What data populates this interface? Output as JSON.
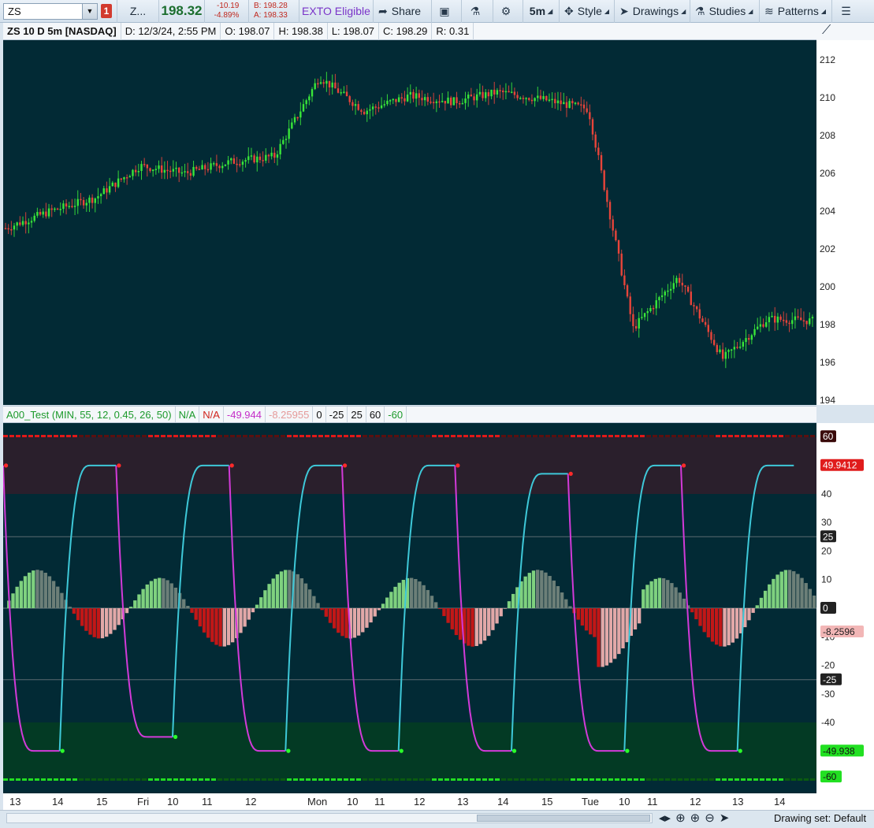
{
  "toolbar": {
    "symbol": "ZS",
    "link_badge": "1",
    "symbol_short": "Z...",
    "last": "198.32",
    "change": "-10.19",
    "change_pct": "-4.89%",
    "bid": "B: 198.28",
    "ask": "A: 198.33",
    "exto": "EXTO Eligible",
    "share": "Share",
    "timeframe": "5m",
    "style": "Style",
    "drawings": "Drawings",
    "studies": "Studies",
    "patterns": "Patterns"
  },
  "infobar": {
    "title": "ZS 10 D 5m [NASDAQ]",
    "date": "D: 12/3/24, 2:55 PM",
    "open": "O: 198.07",
    "high": "H: 198.38",
    "low": "L: 198.07",
    "close": "C: 198.29",
    "range": "R: 0.31"
  },
  "studybar": {
    "name": "A00_Test (MIN, 55, 12, 0.45, 26, 50)",
    "v1": "N/A",
    "v2": "N/A",
    "v3": "-49.944",
    "v4": "-8.25955",
    "v5": "0",
    "v6": "-25",
    "v7": "25",
    "v8": "60",
    "v9": "-60"
  },
  "price_axis": [
    "212",
    "210",
    "208",
    "206",
    "204",
    "202",
    "200",
    "198",
    "196",
    "194"
  ],
  "osc_axis": [
    "40",
    "30",
    "20",
    "10",
    "-10",
    "-20",
    "-30",
    "-40"
  ],
  "osc_badges": {
    "b60": "60",
    "b_cur": "49.9412",
    "b25": "25",
    "b0": "0",
    "b_hist": "-8.2596",
    "bm25": "-25",
    "b_low": "-49.938",
    "bm60": "-60"
  },
  "x_labels": [
    "13",
    "14",
    "15",
    "Fri",
    "10",
    "11",
    "12",
    "Mon",
    "10",
    "11",
    "12",
    "13",
    "14",
    "15",
    "Tue",
    "10",
    "11",
    "12",
    "13",
    "14"
  ],
  "bottom": {
    "drawing_set": "Drawing set: Default"
  },
  "colors": {
    "bg": "#022a35",
    "up": "#39e639",
    "down": "#e8443a",
    "cyan": "#3ec8d8",
    "magenta": "#d23ad8"
  },
  "chart_data": [
    {
      "type": "candlestick",
      "title": "ZS 10 D 5m [NASDAQ]",
      "ylim": [
        194,
        213
      ],
      "approx_close_path": [
        203.1,
        204.0,
        204.7,
        206.4,
        206.0,
        206.6,
        206.9,
        211.1,
        209.3,
        210.1,
        209.8,
        210.3,
        209.9,
        209.4,
        197.8,
        200.5,
        196.2,
        198.3,
        198.2
      ]
    },
    {
      "type": "line",
      "series": [
        {
          "name": "",
          "values": [
            49.9,
            -49.9,
            49.9,
            -45,
            49.9,
            -49.9,
            49.9,
            -49.9,
            49.9,
            -49.9,
            47,
            -49.9,
            49.9,
            -49.9,
            49.9
          ]
        }
      ],
      "ylim": [
        -60,
        60
      ],
      "reference_lines": [
        60,
        25,
        0,
        -25,
        -60
      ]
    }
  ]
}
